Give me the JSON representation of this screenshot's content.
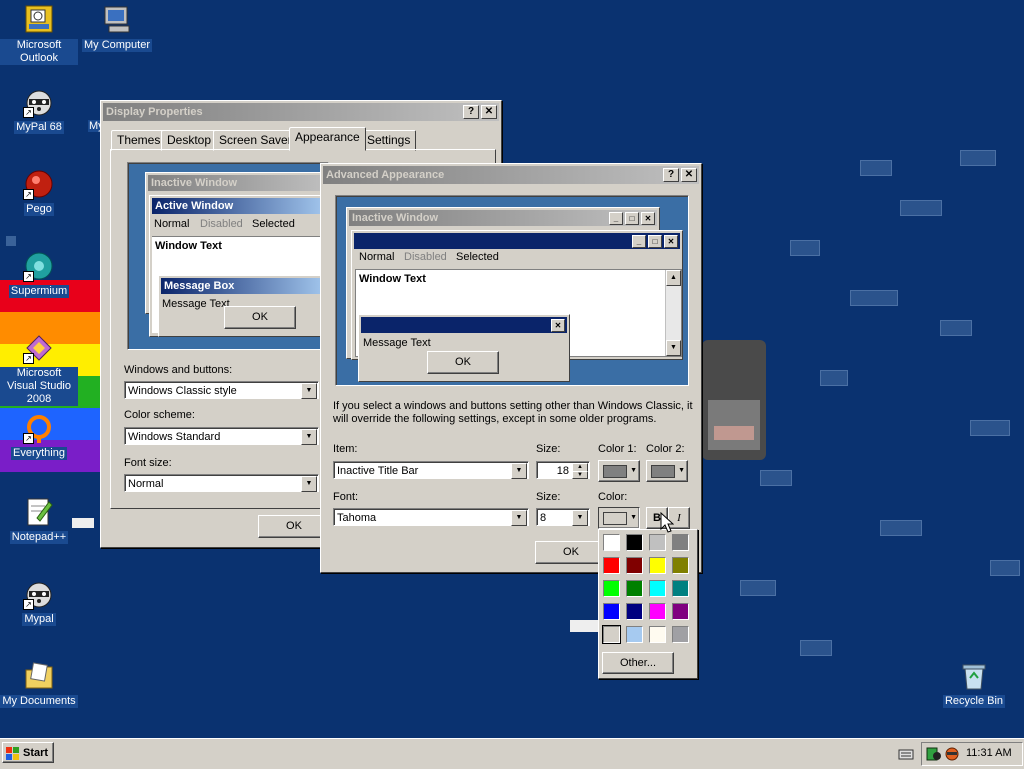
{
  "desktop": {
    "icons": [
      {
        "label": "Microsoft Outlook",
        "icon": "outlook-icon",
        "shortcut": false
      },
      {
        "label": "My Computer",
        "icon": "computer-icon",
        "shortcut": false
      },
      {
        "label": "MyPal 68",
        "icon": "raccoon-icon",
        "shortcut": true
      },
      {
        "label": "Pego",
        "icon": "pego-icon",
        "shortcut": true
      },
      {
        "label": "Supermium",
        "icon": "supermium-icon",
        "shortcut": true
      },
      {
        "label": "Microsoft Visual Studio 2008",
        "icon": "visual-studio-icon",
        "shortcut": true
      },
      {
        "label": "Everything",
        "icon": "everything-icon",
        "shortcut": true
      },
      {
        "label": "Notepad++",
        "icon": "notepadpp-icon",
        "shortcut": false
      },
      {
        "label": "Mypal",
        "icon": "raccoon-icon",
        "shortcut": true
      },
      {
        "label": "My Documents",
        "icon": "documents-folder-icon",
        "shortcut": false
      },
      {
        "label": "Recycle Bin",
        "icon": "recycle-bin-icon",
        "shortcut": false
      }
    ],
    "partial_label": "My"
  },
  "display_properties": {
    "title": "Display Properties",
    "tabs": [
      "Themes",
      "Desktop",
      "Screen Saver",
      "Appearance",
      "Settings"
    ],
    "selected_tab": "Appearance",
    "preview": {
      "inactive_title": "Inactive Window",
      "active_title": "Active Window",
      "menu_normal": "Normal",
      "menu_disabled": "Disabled",
      "menu_selected": "Selected",
      "window_text": "Window Text",
      "msgbox_title": "Message Box",
      "msgbox_text": "Message Text",
      "ok": "OK"
    },
    "windows_buttons_label": "Windows and buttons:",
    "windows_buttons_value": "Windows Classic style",
    "color_scheme_label": "Color scheme:",
    "color_scheme_value": "Windows Standard",
    "font_size_label": "Font size:",
    "font_size_value": "Normal",
    "ok_button": "OK",
    "help_glyph": "?",
    "close_glyph": "✕"
  },
  "advanced_appearance": {
    "title": "Advanced Appearance",
    "preview": {
      "inactive_title": "Inactive Window",
      "menu_normal": "Normal",
      "menu_disabled": "Disabled",
      "menu_selected": "Selected",
      "window_text": "Window Text",
      "msgbox_text": "Message Text",
      "ok": "OK"
    },
    "info_text": "If you select a windows and buttons setting other than Windows Classic, it will override the following settings, except in some older programs.",
    "item_label": "Item:",
    "item_value": "Inactive Title Bar",
    "size_label": "Size:",
    "size_value": "18",
    "color1_label": "Color 1:",
    "color2_label": "Color 2:",
    "font_label": "Font:",
    "font_value": "Tahoma",
    "font_size_label": "Size:",
    "font_size_value": "8",
    "font_color_label": "Color:",
    "bold_button": "B",
    "italic_button": "I",
    "ok_button": "OK",
    "color1": "#808080",
    "color2": "#808080",
    "font_color": "#d4d0c8"
  },
  "color_popup": {
    "colors": [
      "#ffffff",
      "#000000",
      "#c0c0c0",
      "#808080",
      "#ff0000",
      "#800000",
      "#ffff00",
      "#808000",
      "#00ff00",
      "#008000",
      "#00ffff",
      "#008080",
      "#0000ff",
      "#000080",
      "#ff00ff",
      "#800080",
      "#d4d0c8",
      "#a6caf0",
      "#fffbf0",
      "#a0a0a4"
    ],
    "selected_index": 16,
    "other_button": "Other..."
  },
  "taskbar": {
    "start_label": "Start",
    "clock": "11:31 AM"
  },
  "colors": {
    "desktop_bg": "#0a3270",
    "title_active": "#0a246a",
    "title_inactive": "#808080",
    "face": "#d4d0c8"
  }
}
